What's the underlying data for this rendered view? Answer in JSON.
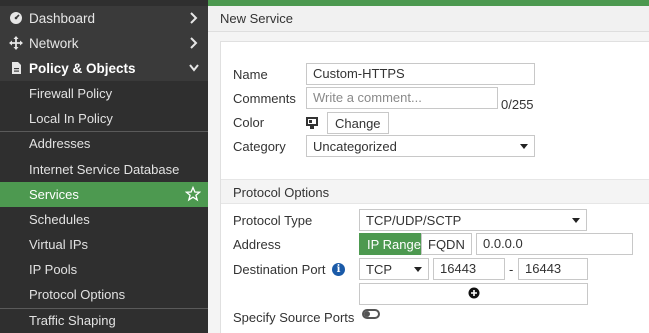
{
  "sidebar": {
    "top_items": [
      {
        "label": "Dashboard",
        "icon": "dashboard-icon"
      },
      {
        "label": "Network",
        "icon": "network-move-icon"
      },
      {
        "label": "Policy & Objects",
        "icon": "policy-document-icon"
      }
    ],
    "sub_items": [
      {
        "label": "Firewall Policy"
      },
      {
        "label": "Local In Policy"
      },
      {
        "label": "Addresses"
      },
      {
        "label": "Internet Service Database"
      },
      {
        "label": "Services"
      },
      {
        "label": "Schedules"
      },
      {
        "label": "Virtual IPs"
      },
      {
        "label": "IP Pools"
      },
      {
        "label": "Protocol Options"
      },
      {
        "label": "Traffic Shaping"
      }
    ],
    "selected": "Services"
  },
  "header": {
    "title": "New Service"
  },
  "form": {
    "name_label": "Name",
    "name_value": "Custom-HTTPS",
    "comments_label": "Comments",
    "comments_placeholder": "Write a comment...",
    "comments_counter": "0/255",
    "color_label": "Color",
    "color_button": "Change",
    "category_label": "Category",
    "category_value": "Uncategorized"
  },
  "protocol_options": {
    "section_title": "Protocol Options",
    "protocol_type_label": "Protocol Type",
    "protocol_type_value": "TCP/UDP/SCTP",
    "address_label": "Address",
    "address_mode_ip": "IP Range",
    "address_mode_fqdn": "FQDN",
    "address_value": "0.0.0.0",
    "dest_port_label": "Destination Port",
    "dest_port_protocol": "TCP",
    "dest_port_low": "16443",
    "dest_port_dash": "-",
    "dest_port_high": "16443",
    "specify_source_label": "Specify Source Ports"
  },
  "colors": {
    "accent_green": "#4d9950",
    "sidebar_bg": "#2f2f2f",
    "info_blue": "#1a5aa8"
  }
}
